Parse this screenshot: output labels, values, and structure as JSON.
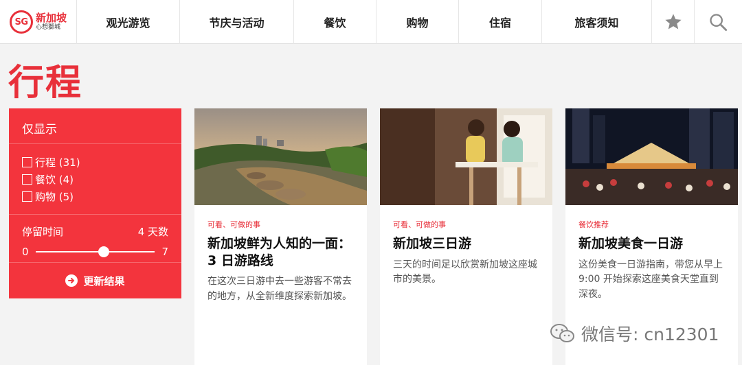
{
  "logo": {
    "badge": "SG",
    "main": "新加坡",
    "sub": "心想獅城"
  },
  "nav": {
    "items": [
      "观光游览",
      "节庆与活动",
      "餐饮",
      "购物",
      "住宿",
      "旅客须知"
    ],
    "favorites_icon": "star-icon",
    "search_icon": "search-icon"
  },
  "page_title": "行程",
  "filter": {
    "heading": "仅显示",
    "options": [
      "行程 (31)",
      "餐饮 (4)",
      "购物 (5)"
    ],
    "stay_label": "停留时间",
    "stay_value": "4 天数",
    "slider_min": "0",
    "slider_max": "7",
    "slider_value_fraction": 0.571,
    "update_label": "更新结果"
  },
  "cards": [
    {
      "category": "可看、可做的事",
      "title": "新加坡鲜为人知的一面：3 日游路线",
      "desc": "在这次三日游中去一些游客不常去的地方，从全新维度探索新加坡。"
    },
    {
      "category": "可看、可做的事",
      "title": "新加坡三日游",
      "desc": "三天的时间足以欣赏新加坡这座城市的美景。"
    },
    {
      "category": "餐饮推荐",
      "title": "新加坡美食一日游",
      "desc": "这份美食一日游指南，带您从早上 9:00 开始探索这座美食天堂直到深夜。"
    }
  ],
  "watermark": "微信号: cn12301",
  "colors": {
    "brand_red": "#e8303a",
    "panel_red": "#f3343d"
  }
}
